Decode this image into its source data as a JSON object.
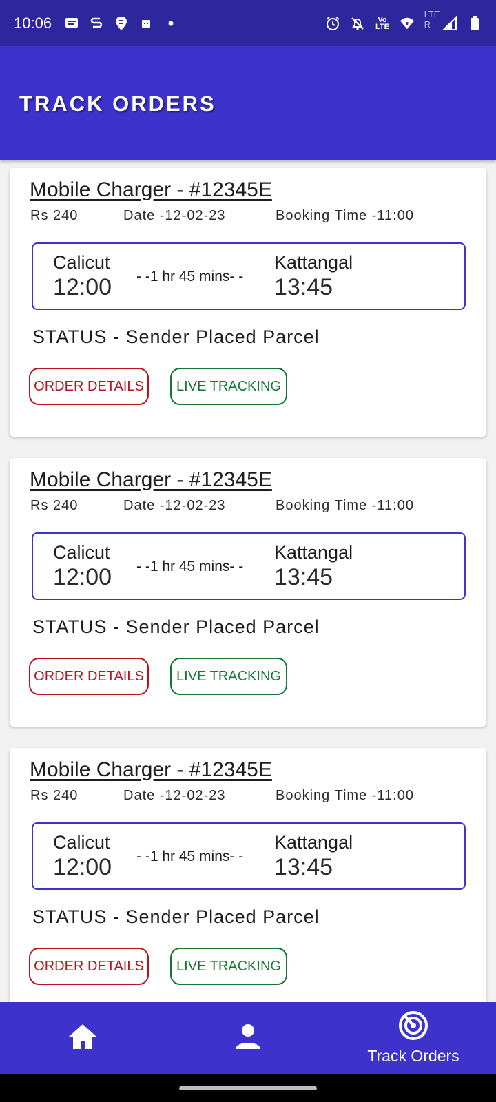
{
  "status_bar": {
    "time": "10:06",
    "network_label": "Vo LTE",
    "lte_label": "LTE R"
  },
  "app_bar": {
    "title": "TRACK ORDERS"
  },
  "orders": [
    {
      "title": "Mobile Charger - #12345E",
      "price": "Rs 240",
      "date": "Date -12-02-23",
      "booking_time": "Booking Time -11:00",
      "from_city": "Calicut",
      "from_time": "12:00",
      "duration": "- -1 hr 45 mins- -",
      "to_city": "Kattangal",
      "to_time": "13:45",
      "status": "STATUS - Sender Placed Parcel",
      "order_details_label": "ORDER DETAILS",
      "live_tracking_label": "LIVE TRACKING"
    },
    {
      "title": "Mobile Charger - #12345E",
      "price": "Rs 240",
      "date": "Date -12-02-23",
      "booking_time": "Booking Time -11:00",
      "from_city": "Calicut",
      "from_time": "12:00",
      "duration": "- -1 hr 45 mins- -",
      "to_city": "Kattangal",
      "to_time": "13:45",
      "status": "STATUS - Sender Placed Parcel",
      "order_details_label": "ORDER DETAILS",
      "live_tracking_label": "LIVE TRACKING"
    },
    {
      "title": "Mobile Charger - #12345E",
      "price": "Rs 240",
      "date": "Date -12-02-23",
      "booking_time": "Booking Time -11:00",
      "from_city": "Calicut",
      "from_time": "12:00",
      "duration": "- -1 hr 45 mins- -",
      "to_city": "Kattangal",
      "to_time": "13:45",
      "status": "STATUS - Sender Placed Parcel",
      "order_details_label": "ORDER DETAILS",
      "live_tracking_label": "LIVE TRACKING"
    }
  ],
  "bottom_nav": {
    "items": [
      {
        "icon": "home-icon"
      },
      {
        "icon": "person-icon"
      },
      {
        "icon": "radar-icon",
        "label": "Track Orders"
      }
    ]
  },
  "colors": {
    "status_bar": "#2e269c",
    "primary": "#3d32cc",
    "order_details": "#b8141c",
    "live_tracking": "#16762f"
  }
}
